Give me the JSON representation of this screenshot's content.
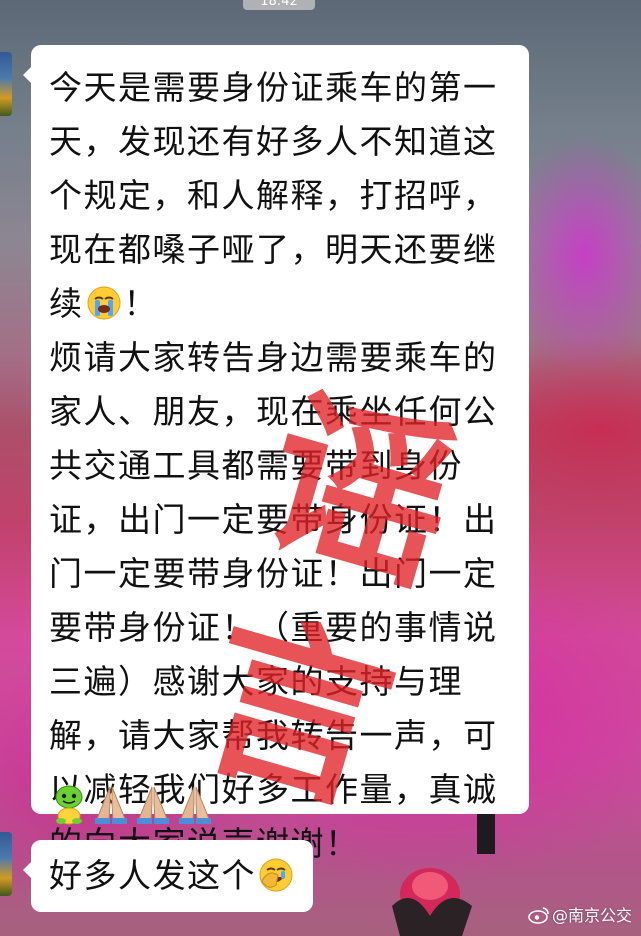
{
  "chat": {
    "timestamp": "18:42",
    "messages": [
      {
        "part1": "今天是需要身份证乘车的第一天，发现还有好多人不知道这个规定，和人解释，打招呼，现在都嗓子哑了，明天还要继续",
        "emoji_after_part1": "loudly-crying-face-icon",
        "part2": "！\n烦请大家转告身边需要乘车的家人、朋友，现在乘坐任何公共交通工具都需要带到身份证，出门一定要带身份证！出门一定要带身份证！出门一定要带身份证！（重要的事情说三遍）感谢大家的支持与理解，请大家帮我转告一声，可以减轻我们好多工作量，真诚的向大家说声谢谢！",
        "trailing_emojis": [
          "green-sprout-face-icon",
          "folded-hands-icon",
          "folded-hands-icon",
          "folded-hands-icon"
        ]
      },
      {
        "text": "好多人发这个",
        "emoji_after_text": "face-with-hand-over-eyes-laughing-icon"
      }
    ]
  },
  "stamp": {
    "text": "谣言",
    "color": "#e22228"
  },
  "watermark": {
    "icon": "weibo-icon",
    "text": "@南京公交"
  }
}
